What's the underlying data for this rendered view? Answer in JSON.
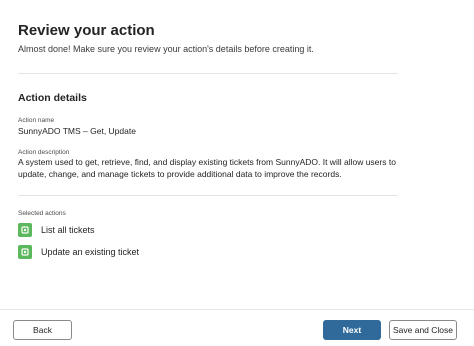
{
  "header": {
    "title": "Review your action",
    "subtitle": "Almost done! Make sure you review your action's details before creating it."
  },
  "details": {
    "section_title": "Action details",
    "name_label": "Action name",
    "name_value": "SunnyADO TMS – Get, Update",
    "description_label": "Action description",
    "description_value": "A system used to get, retrieve, find, and display existing tickets from SunnyADO. It will allow users to update, change, and manage tickets to provide additional data to improve the records."
  },
  "selected_actions": {
    "label": "Selected actions",
    "items": [
      {
        "label": "List all tickets",
        "icon": "green-action-icon"
      },
      {
        "label": "Update an existing ticket",
        "icon": "green-action-icon"
      }
    ]
  },
  "footer": {
    "back_label": "Back",
    "next_label": "Next",
    "save_close_label": "Save and Close"
  },
  "colors": {
    "primary_button": "#2f6a9b",
    "action_icon": "#5cb85c"
  }
}
